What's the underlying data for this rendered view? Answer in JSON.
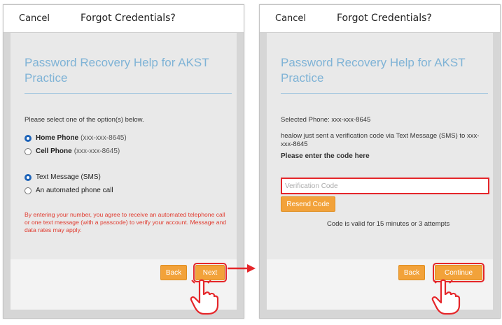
{
  "left": {
    "topbar": {
      "cancel": "Cancel",
      "title": "Forgot Credentials?"
    },
    "heading": "Password Recovery Help for AKST Practice",
    "prompt": "Please select one of the option(s) below.",
    "phone_options": [
      {
        "label": "Home Phone",
        "detail": "(xxx-xxx-8645)",
        "selected": true
      },
      {
        "label": "Cell Phone",
        "detail": "(xxx-xxx-8645)",
        "selected": false
      }
    ],
    "method_options": [
      {
        "label": "Text Message (SMS)",
        "selected": true
      },
      {
        "label": "An automated phone call",
        "selected": false
      }
    ],
    "disclaimer": "By entering your number, you agree to receive an automated telephone call or one text message (with a passcode) to verify your account. Message and data rates may apply.",
    "buttons": {
      "back": "Back",
      "next": "Next"
    }
  },
  "right": {
    "topbar": {
      "cancel": "Cancel",
      "title": "Forgot Credentials?"
    },
    "heading": "Password Recovery Help for AKST Practice",
    "selected_phone": "Selected Phone: xxx-xxx-8645",
    "sent_message": "healow just sent a verification code via Text Message (SMS) to xxx-xxx-8645",
    "enter_code": "Please enter the code here",
    "input": {
      "placeholder": "Verification Code",
      "value": ""
    },
    "resend": "Resend Code",
    "validity": "Code is valid for 15 minutes or 3 attempts",
    "buttons": {
      "back": "Back",
      "continue": "Continue"
    }
  },
  "colors": {
    "accent_orange": "#f2a23a",
    "heading_blue": "#7fb3d6",
    "highlight_red": "#e5262a",
    "disclaimer_red": "#e03a2e",
    "radio_blue": "#1d63b8"
  },
  "icons": [
    "right-arrow-icon",
    "pointing-hand-icon"
  ]
}
